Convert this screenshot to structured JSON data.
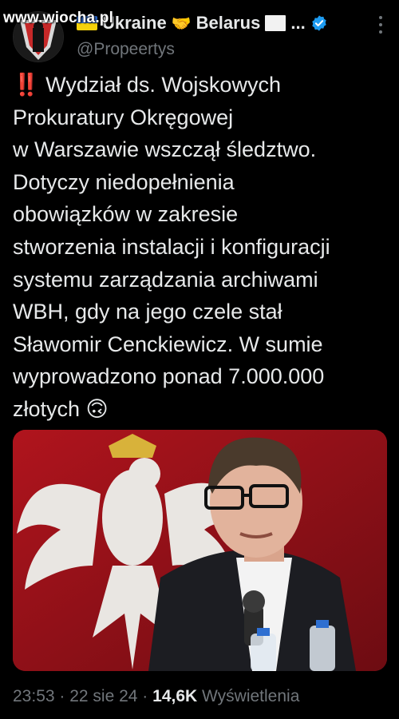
{
  "watermark": "www.wiocha.pl",
  "author": {
    "name_left": "Ukraine",
    "handshake": "🤝",
    "name_right": "Belarus",
    "ellipsis": "...",
    "handle": "@Propeertys"
  },
  "tweet": {
    "prefix": "‼️",
    "text": " Wydział ds. Wojskowych\nProkuratury Okręgowej\nw Warszawie wszczął śledztwo.\nDotyczy niedopełnienia\nobowiązków w zakresie\nstworzenia instalacji i konfiguracji\nsystemu zarządzania archiwami\nWBH, gdy na jego czele stał\nSławomir Cenckiewicz. W sumie\nwyprowadzono ponad 7.000.000\nzłotych ",
    "emoji": "🙃"
  },
  "meta": {
    "time": "23:53",
    "sep1": " · ",
    "date": "22 sie 24",
    "sep2": " · ",
    "views_count": "14,6K",
    "views_label": " Wyświetlenia"
  },
  "colors": {
    "background": "#000000",
    "text": "#e7e9ea",
    "muted": "#71767b",
    "verified": "#1d9bf0",
    "photo_red": "#a2131b"
  },
  "icons": [
    "ukraine-flag-icon",
    "handshake-icon",
    "white-flag-icon",
    "verified-badge-icon",
    "more-options-icon"
  ]
}
